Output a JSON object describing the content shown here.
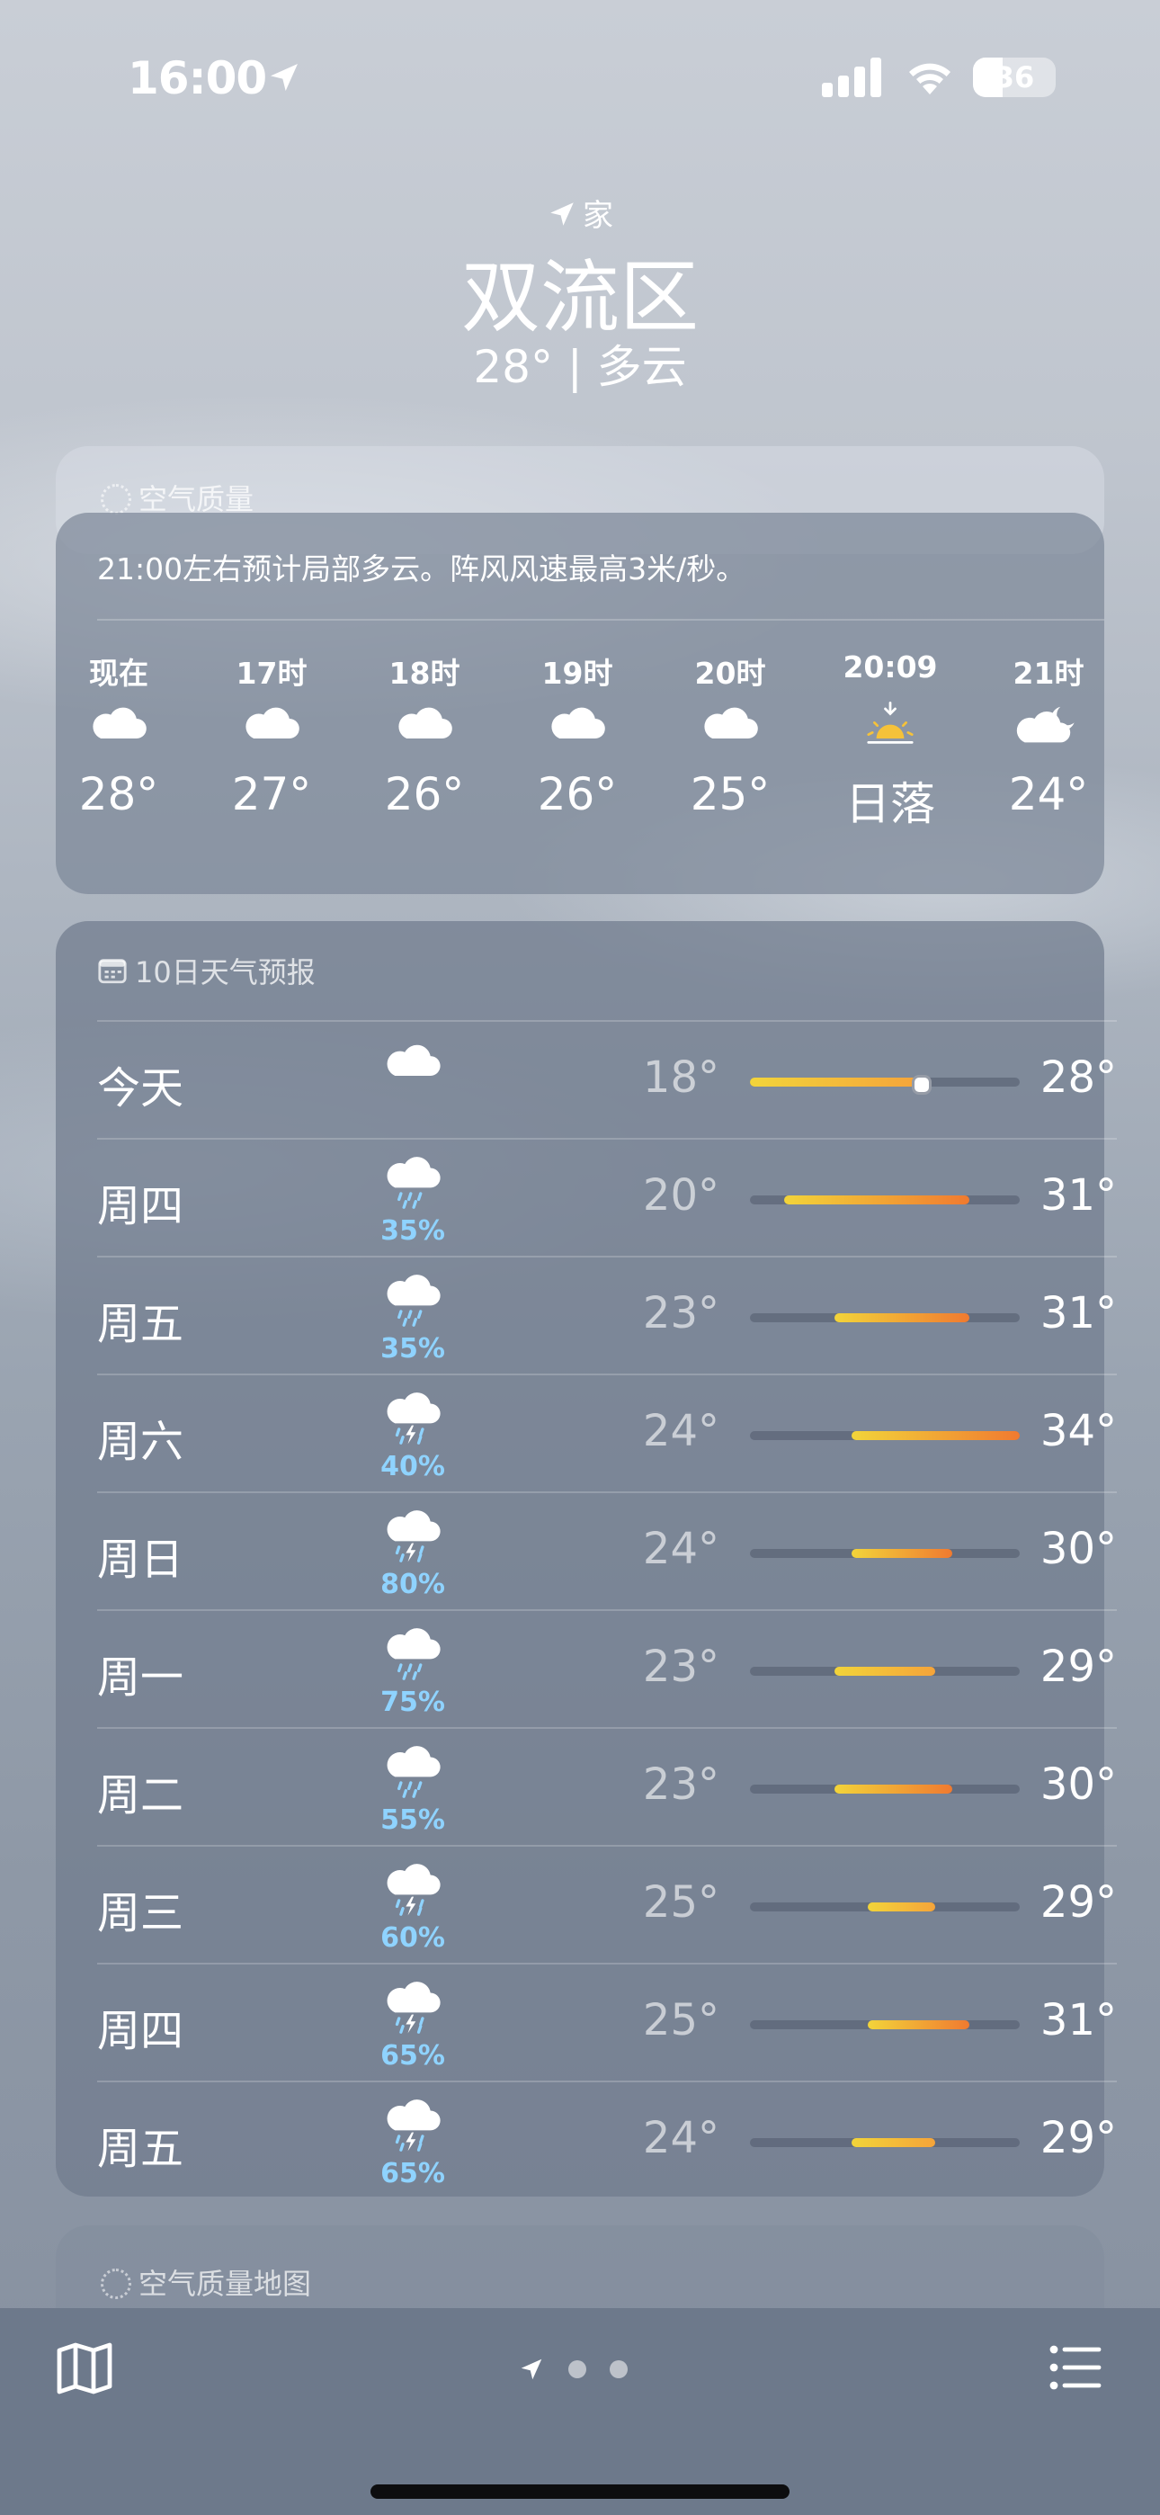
{
  "status_bar": {
    "time": "16:00",
    "battery": "36"
  },
  "header": {
    "location_tag": "家",
    "city": "双流区",
    "current": "28°  |  多云"
  },
  "air_quality": {
    "title": "空气质量"
  },
  "hourly": {
    "summary": "21:00左右预计局部多云。阵风风速最高3米/秒。",
    "items": [
      {
        "time": "现在",
        "icon": "cloud-icon",
        "temp": "28°"
      },
      {
        "time": "17时",
        "icon": "cloud-icon",
        "temp": "27°"
      },
      {
        "time": "18时",
        "icon": "cloud-icon",
        "temp": "26°"
      },
      {
        "time": "19时",
        "icon": "cloud-icon",
        "temp": "26°"
      },
      {
        "time": "20时",
        "icon": "cloud-icon",
        "temp": "25°"
      },
      {
        "time": "20:09",
        "icon": "sunset-icon",
        "temp": "日落"
      },
      {
        "time": "21时",
        "icon": "cloud-moon-icon",
        "temp": "24°"
      }
    ]
  },
  "ten_day": {
    "title": "10日天气预报",
    "range": [
      18,
      34
    ],
    "current_temp": 28,
    "days": [
      {
        "day": "今天",
        "icon": "cloud-icon",
        "pct": "",
        "low": "18°",
        "high": "28°",
        "low_v": 18,
        "high_v": 28
      },
      {
        "day": "周四",
        "icon": "cloud-rain-icon",
        "pct": "35%",
        "low": "20°",
        "high": "31°",
        "low_v": 20,
        "high_v": 31
      },
      {
        "day": "周五",
        "icon": "cloud-rain-icon",
        "pct": "35%",
        "low": "23°",
        "high": "31°",
        "low_v": 23,
        "high_v": 31
      },
      {
        "day": "周六",
        "icon": "thunderstorm-icon",
        "pct": "40%",
        "low": "24°",
        "high": "34°",
        "low_v": 24,
        "high_v": 34
      },
      {
        "day": "周日",
        "icon": "thunderstorm-icon",
        "pct": "80%",
        "low": "24°",
        "high": "30°",
        "low_v": 24,
        "high_v": 30
      },
      {
        "day": "周一",
        "icon": "cloud-rain-icon",
        "pct": "75%",
        "low": "23°",
        "high": "29°",
        "low_v": 23,
        "high_v": 29
      },
      {
        "day": "周二",
        "icon": "cloud-rain-icon",
        "pct": "55%",
        "low": "23°",
        "high": "30°",
        "low_v": 23,
        "high_v": 30
      },
      {
        "day": "周三",
        "icon": "thunderstorm-icon",
        "pct": "60%",
        "low": "25°",
        "high": "29°",
        "low_v": 25,
        "high_v": 29
      },
      {
        "day": "周四",
        "icon": "thunderstorm-icon",
        "pct": "65%",
        "low": "25°",
        "high": "31°",
        "low_v": 25,
        "high_v": 31
      },
      {
        "day": "周五",
        "icon": "thunderstorm-icon",
        "pct": "65%",
        "low": "24°",
        "high": "29°",
        "low_v": 24,
        "high_v": 29
      }
    ]
  },
  "air_quality_map": {
    "title": "空气质量地图"
  },
  "colors": {
    "precip": "#8fd3ff",
    "cool": "#f2d43a",
    "mid": "#f5a43a",
    "hot": "#f07a30"
  }
}
